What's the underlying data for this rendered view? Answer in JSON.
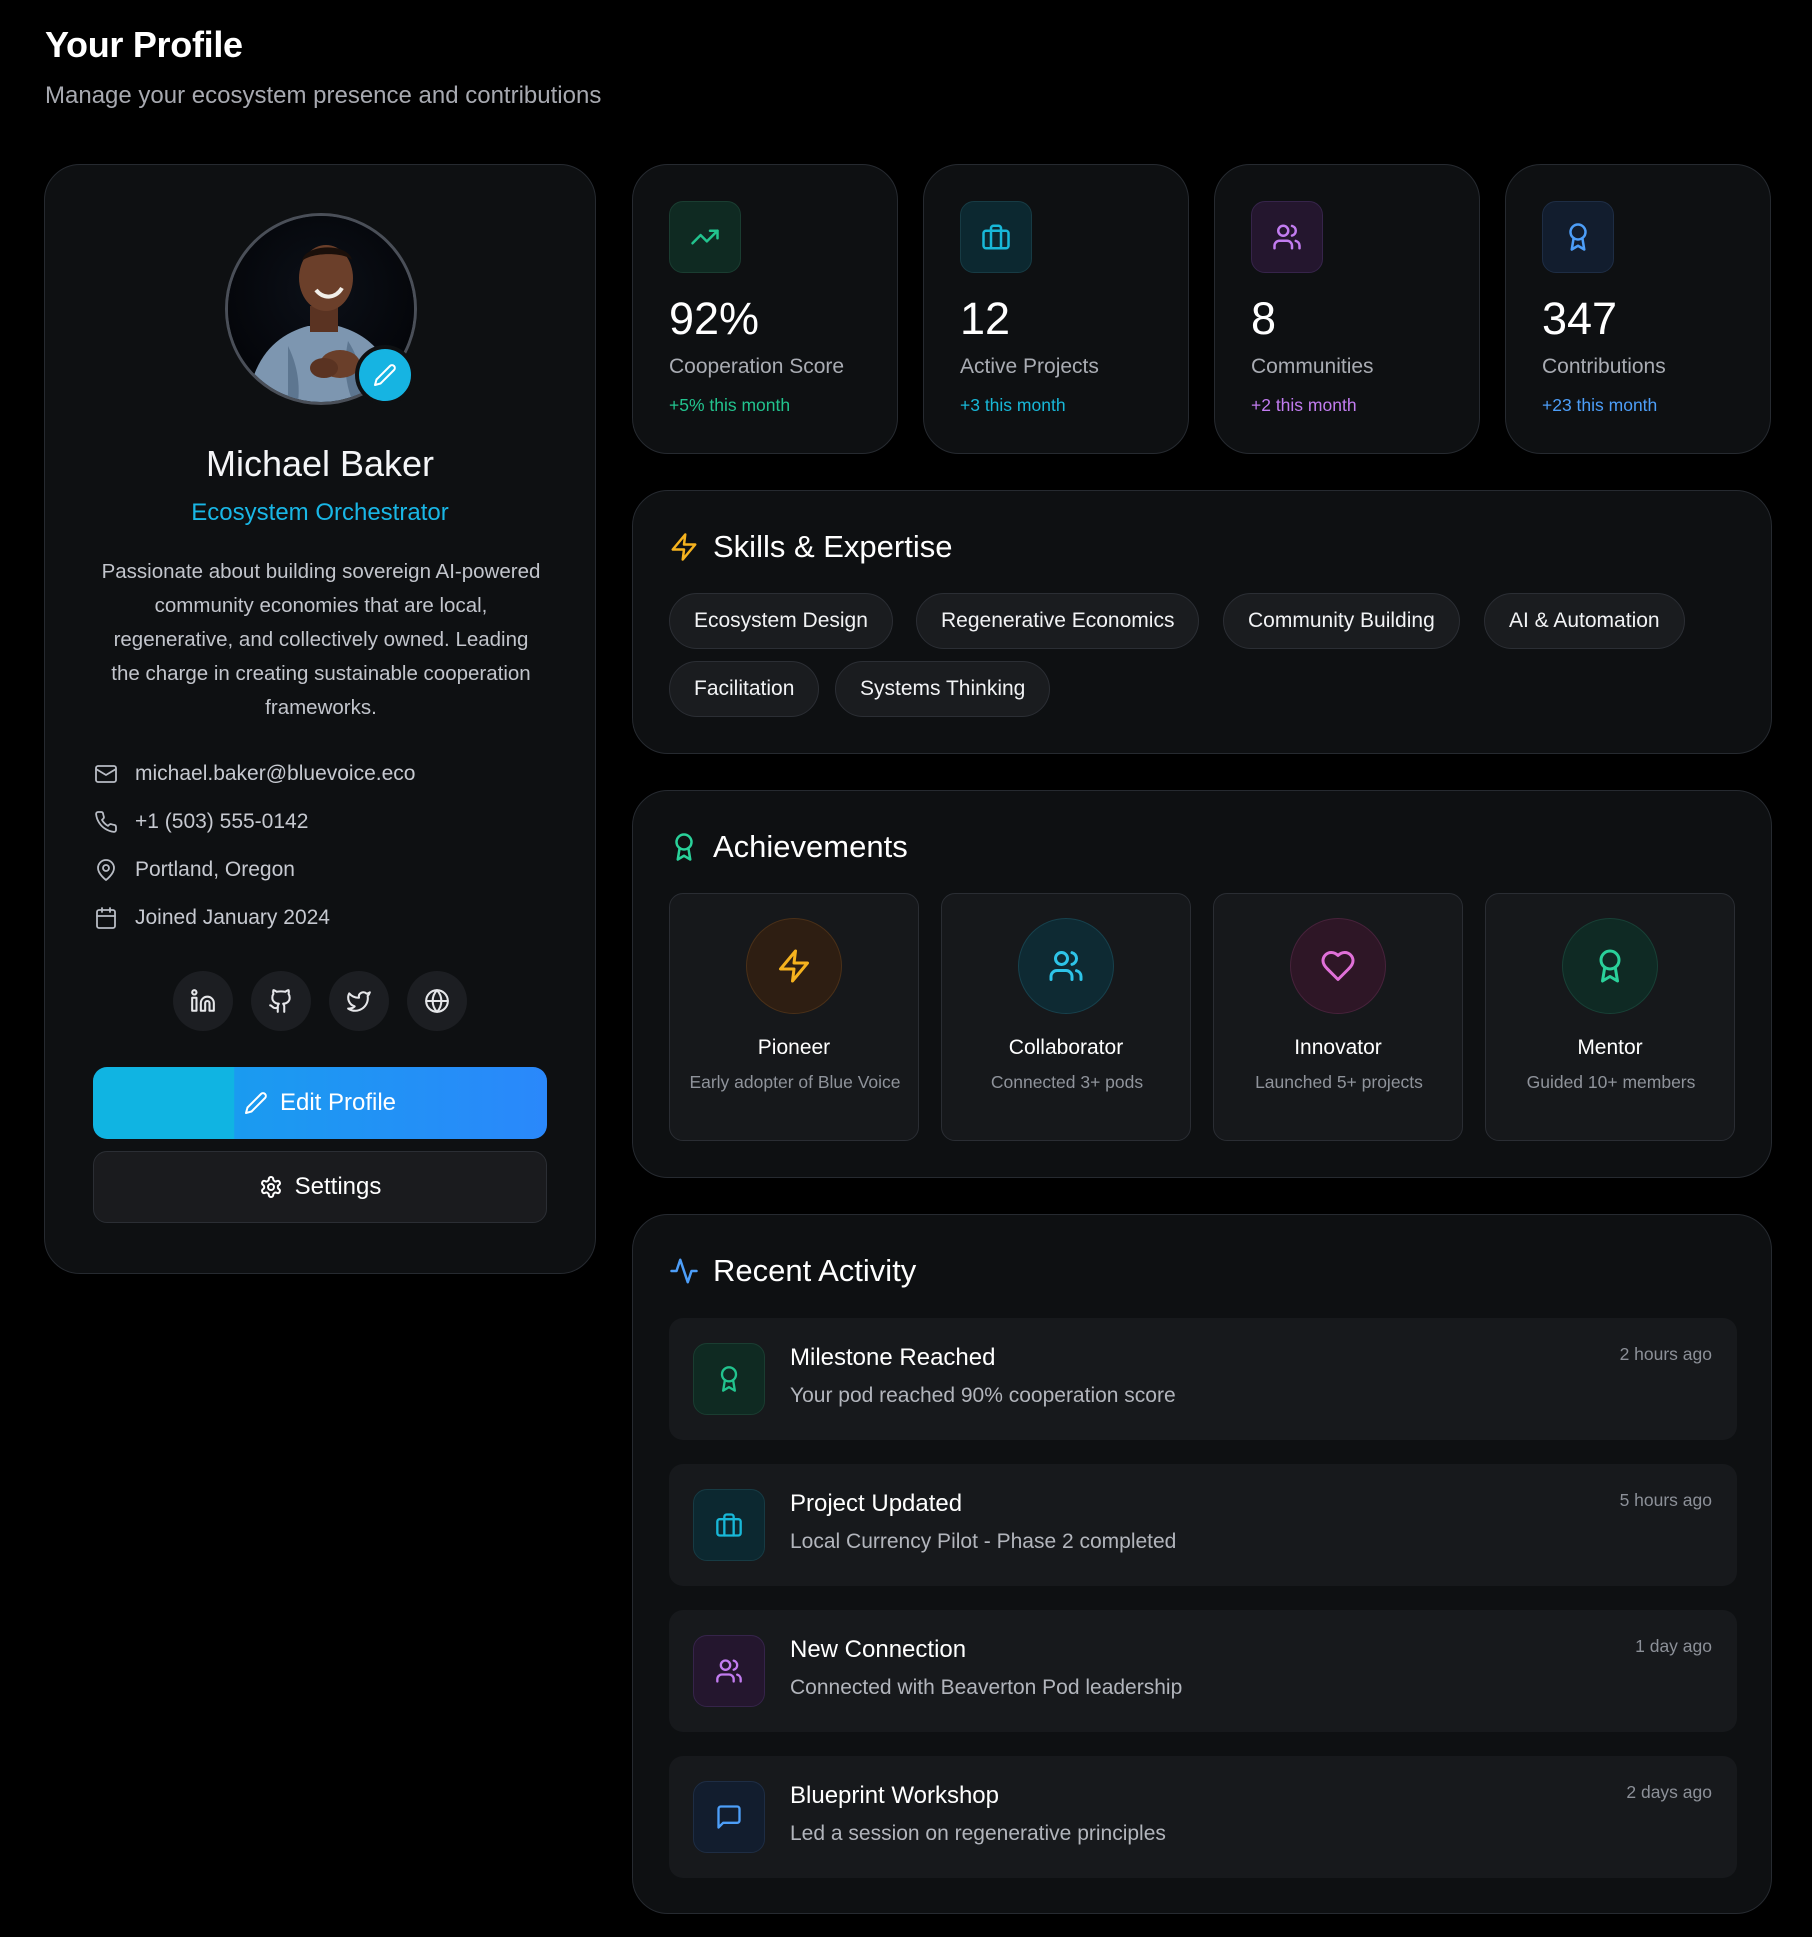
{
  "header": {
    "title": "Your Profile",
    "subtitle": "Manage your ecosystem presence and contributions"
  },
  "profile": {
    "name": "Michael Baker",
    "role": "Ecosystem Orchestrator",
    "bio": "Passionate about building sovereign AI-powered community economies that are local, regenerative, and collectively owned. Leading the charge in creating sustainable cooperation frameworks.",
    "contacts": [
      {
        "icon": "mail-icon",
        "text": "michael.baker@bluevoice.eco"
      },
      {
        "icon": "phone-icon",
        "text": "+1 (503) 555-0142"
      },
      {
        "icon": "map-pin-icon",
        "text": "Portland, Oregon"
      },
      {
        "icon": "calendar-icon",
        "text": "Joined January 2024"
      }
    ],
    "socials": [
      "linkedin-icon",
      "github-icon",
      "twitter-icon",
      "globe-icon"
    ],
    "edit_label": "Edit Profile",
    "settings_label": "Settings"
  },
  "stats": [
    {
      "value": "92%",
      "label": "Cooperation Score",
      "change": "+5% this month",
      "icon": "trending-up-icon",
      "color": "#22c38e"
    },
    {
      "value": "12",
      "label": "Active Projects",
      "change": "+3 this month",
      "icon": "briefcase-icon",
      "color": "#18b8d8"
    },
    {
      "value": "8",
      "label": "Communities",
      "change": "+2 this month",
      "icon": "users-icon",
      "color": "#c27cf0"
    },
    {
      "value": "347",
      "label": "Contributions",
      "change": "+23 this month",
      "icon": "award-icon",
      "color": "#4d9ef8"
    }
  ],
  "skills": {
    "title": "Skills & Expertise",
    "items": [
      "Ecosystem Design",
      "Regenerative Economics",
      "Community Building",
      "AI & Automation",
      "Facilitation",
      "Systems Thinking"
    ]
  },
  "achievements": {
    "title": "Achievements",
    "items": [
      {
        "name": "Pioneer",
        "desc": "Early adopter of Blue Voice",
        "icon": "zap-icon",
        "color": "#f5b21e"
      },
      {
        "name": "Collaborator",
        "desc": "Connected 3+ pods",
        "icon": "users-icon",
        "color": "#2ec4e8"
      },
      {
        "name": "Innovator",
        "desc": "Launched 5+ projects",
        "icon": "heart-icon",
        "color": "#e070d8"
      },
      {
        "name": "Mentor",
        "desc": "Guided 10+ members",
        "icon": "award-icon",
        "color": "#2ad19a"
      }
    ]
  },
  "activity": {
    "title": "Recent Activity",
    "items": [
      {
        "title": "Milestone Reached",
        "desc": "Your pod reached 90% cooperation score",
        "time": "2 hours ago",
        "icon": "award-icon",
        "color": "#22c38e"
      },
      {
        "title": "Project Updated",
        "desc": "Local Currency Pilot - Phase 2 completed",
        "time": "5 hours ago",
        "icon": "briefcase-icon",
        "color": "#18b8d8"
      },
      {
        "title": "New Connection",
        "desc": "Connected with Beaverton Pod leadership",
        "time": "1 day ago",
        "icon": "users-icon",
        "color": "#c27cf0"
      },
      {
        "title": "Blueprint Workshop",
        "desc": "Led a session on regenerative principles",
        "time": "2 days ago",
        "icon": "message-square-icon",
        "color": "#4d9ef8"
      }
    ]
  },
  "colors": {
    "accent": "#19b7e6",
    "background": "#000000",
    "card": "#0e1012",
    "border": "#262a30"
  }
}
